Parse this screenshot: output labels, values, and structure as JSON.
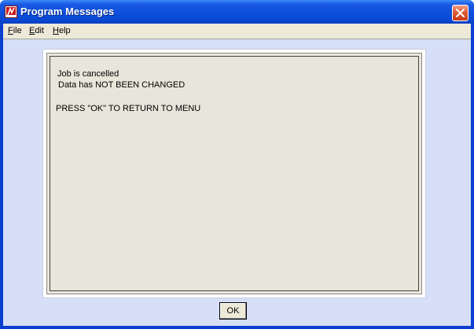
{
  "window": {
    "title": "Program Messages",
    "app_icon": "program-message-icon",
    "close_icon": "close-icon"
  },
  "menu": {
    "items": [
      {
        "label": "File",
        "mnemonic": "F",
        "rest": "ile"
      },
      {
        "label": "Edit",
        "mnemonic": "E",
        "rest": "dit"
      },
      {
        "label": "Help",
        "mnemonic": "H",
        "rest": "elp"
      }
    ]
  },
  "message": {
    "lines": [
      "Job is cancelled",
      "Data has NOT BEEN CHANGED",
      "PRESS \"OK\" TO RETURN TO MENU"
    ]
  },
  "buttons": {
    "ok_label": "OK"
  },
  "colors": {
    "titlebar": "#0c4fdc",
    "client_background": "#d6dff7",
    "panel_background": "#e8e5da",
    "menu_background": "#ece9d8",
    "close_button": "#e0603c"
  }
}
